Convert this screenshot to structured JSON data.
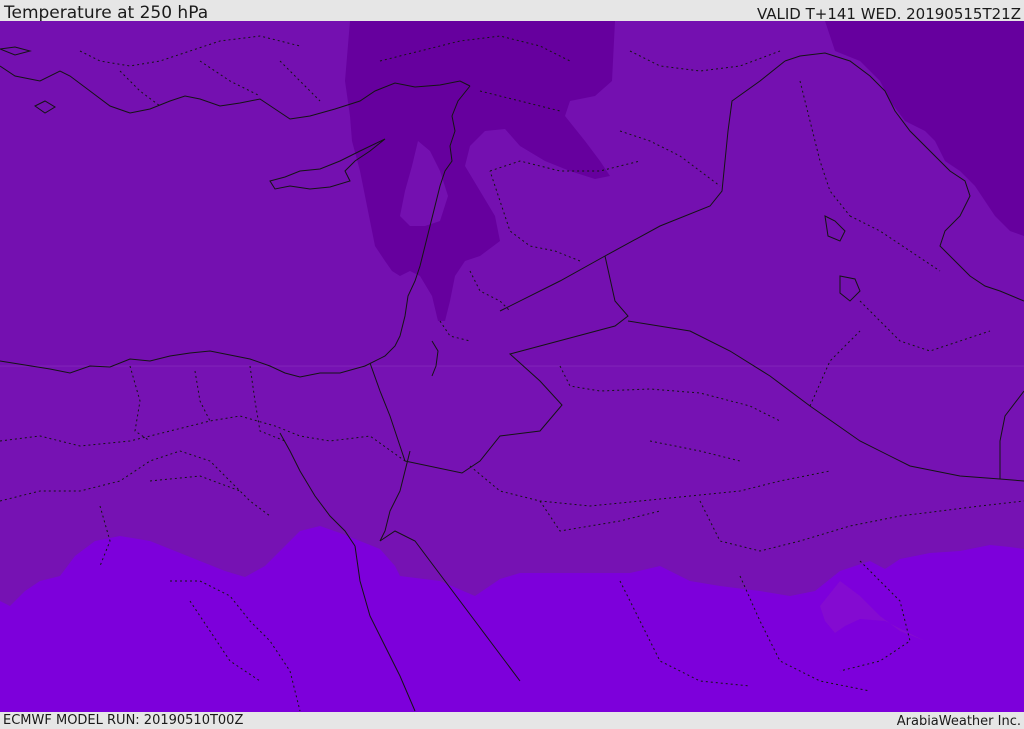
{
  "header": {
    "title": "Temperature at 250 hPa",
    "valid": "VALID T+141 WED. 20190515T21Z"
  },
  "footer": {
    "model_run": "ECMWF MODEL RUN: 20190510T00Z",
    "credit": "ArabiaWeather Inc."
  },
  "map": {
    "colors": {
      "band_cold": "#66009e",
      "band_mid": "#7410b0",
      "band_warm_mid": "#7a14b8",
      "band_warm": "#7d00db",
      "boundary": "#141414"
    }
  }
}
